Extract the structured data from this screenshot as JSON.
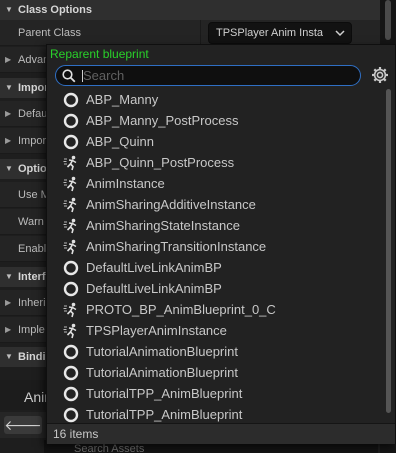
{
  "details": {
    "categories": {
      "class_options": "Class Options",
      "import": "Impor",
      "options": "Optio",
      "interfaces": "Interf",
      "binding": "Bindin"
    },
    "rows": {
      "parent_class": "Parent Class",
      "advanced": "Advan",
      "default": "Defau",
      "import": "Impor",
      "use_m": "Use M",
      "warn": "Warn",
      "enable": "Enabl",
      "inherited": "Inheri",
      "implemented": "Imple"
    },
    "parent_class_value": "TPSPlayer Anim Insta",
    "anim_label": "Anim",
    "search_assets_placeholder": "Search Assets"
  },
  "picker": {
    "title": "Reparent blueprint",
    "search_placeholder": "Search",
    "items": [
      {
        "name": "ABP_Manny",
        "icon": "blueprint-circle-icon"
      },
      {
        "name": "ABP_Manny_PostProcess",
        "icon": "blueprint-circle-icon"
      },
      {
        "name": "ABP_Quinn",
        "icon": "blueprint-circle-icon"
      },
      {
        "name": "ABP_Quinn_PostProcess",
        "icon": "anim-instance-icon"
      },
      {
        "name": "AnimInstance",
        "icon": "anim-instance-icon"
      },
      {
        "name": "AnimSharingAdditiveInstance",
        "icon": "anim-instance-icon"
      },
      {
        "name": "AnimSharingStateInstance",
        "icon": "anim-instance-icon"
      },
      {
        "name": "AnimSharingTransitionInstance",
        "icon": "anim-instance-icon"
      },
      {
        "name": "DefaultLiveLinkAnimBP",
        "icon": "blueprint-circle-icon"
      },
      {
        "name": "DefaultLiveLinkAnimBP",
        "icon": "blueprint-circle-icon"
      },
      {
        "name": "PROTO_BP_AnimBlueprint_0_C",
        "icon": "anim-instance-icon"
      },
      {
        "name": "TPSPlayerAnimInstance",
        "icon": "anim-instance-icon"
      },
      {
        "name": "TutorialAnimationBlueprint",
        "icon": "blueprint-circle-icon"
      },
      {
        "name": "TutorialAnimationBlueprint",
        "icon": "blueprint-circle-icon"
      },
      {
        "name": "TutorialTPP_AnimBlueprint",
        "icon": "blueprint-circle-icon"
      },
      {
        "name": "TutorialTPP_AnimBlueprint",
        "icon": "blueprint-circle-icon"
      }
    ],
    "count_label": "16 items"
  },
  "colors": {
    "title_green": "#29d12a",
    "focus_blue": "#2f6fc4"
  }
}
